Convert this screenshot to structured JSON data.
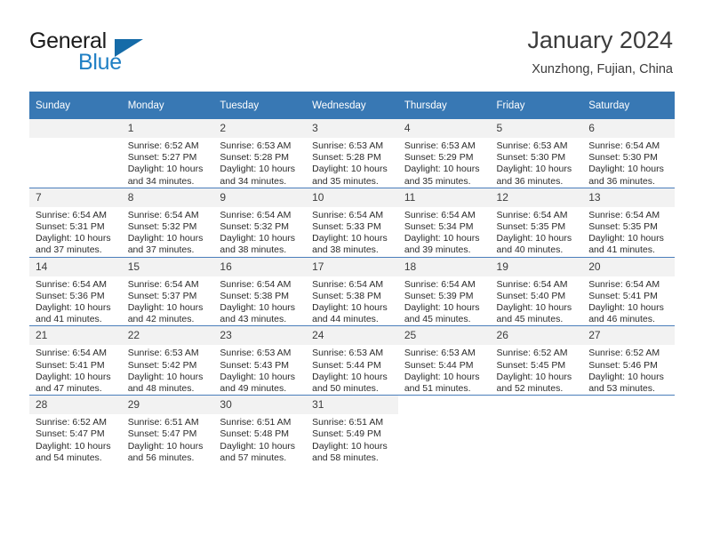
{
  "brand": {
    "name_part1": "General",
    "name_part2": "Blue",
    "triangle_color": "#156ba8",
    "blue_color": "#1f7fc4"
  },
  "header": {
    "title": "January 2024",
    "location": "Xunzhong, Fujian, China"
  },
  "theme": {
    "header_row_bg": "#3878b4",
    "header_row_text": "#ffffff",
    "daynum_bg": "#f2f2f2",
    "row_divider": "#4a7ebb",
    "body_text": "#2b2b2b"
  },
  "weekday_headers": [
    "Sunday",
    "Monday",
    "Tuesday",
    "Wednesday",
    "Thursday",
    "Friday",
    "Saturday"
  ],
  "weeks": [
    [
      {
        "day": "",
        "empty": true,
        "sunrise": "",
        "sunset": "",
        "daylight1": "",
        "daylight2": ""
      },
      {
        "day": "1",
        "sunrise": "Sunrise: 6:52 AM",
        "sunset": "Sunset: 5:27 PM",
        "daylight1": "Daylight: 10 hours",
        "daylight2": "and 34 minutes."
      },
      {
        "day": "2",
        "sunrise": "Sunrise: 6:53 AM",
        "sunset": "Sunset: 5:28 PM",
        "daylight1": "Daylight: 10 hours",
        "daylight2": "and 34 minutes."
      },
      {
        "day": "3",
        "sunrise": "Sunrise: 6:53 AM",
        "sunset": "Sunset: 5:28 PM",
        "daylight1": "Daylight: 10 hours",
        "daylight2": "and 35 minutes."
      },
      {
        "day": "4",
        "sunrise": "Sunrise: 6:53 AM",
        "sunset": "Sunset: 5:29 PM",
        "daylight1": "Daylight: 10 hours",
        "daylight2": "and 35 minutes."
      },
      {
        "day": "5",
        "sunrise": "Sunrise: 6:53 AM",
        "sunset": "Sunset: 5:30 PM",
        "daylight1": "Daylight: 10 hours",
        "daylight2": "and 36 minutes."
      },
      {
        "day": "6",
        "sunrise": "Sunrise: 6:54 AM",
        "sunset": "Sunset: 5:30 PM",
        "daylight1": "Daylight: 10 hours",
        "daylight2": "and 36 minutes."
      }
    ],
    [
      {
        "day": "7",
        "sunrise": "Sunrise: 6:54 AM",
        "sunset": "Sunset: 5:31 PM",
        "daylight1": "Daylight: 10 hours",
        "daylight2": "and 37 minutes."
      },
      {
        "day": "8",
        "sunrise": "Sunrise: 6:54 AM",
        "sunset": "Sunset: 5:32 PM",
        "daylight1": "Daylight: 10 hours",
        "daylight2": "and 37 minutes."
      },
      {
        "day": "9",
        "sunrise": "Sunrise: 6:54 AM",
        "sunset": "Sunset: 5:32 PM",
        "daylight1": "Daylight: 10 hours",
        "daylight2": "and 38 minutes."
      },
      {
        "day": "10",
        "sunrise": "Sunrise: 6:54 AM",
        "sunset": "Sunset: 5:33 PM",
        "daylight1": "Daylight: 10 hours",
        "daylight2": "and 38 minutes."
      },
      {
        "day": "11",
        "sunrise": "Sunrise: 6:54 AM",
        "sunset": "Sunset: 5:34 PM",
        "daylight1": "Daylight: 10 hours",
        "daylight2": "and 39 minutes."
      },
      {
        "day": "12",
        "sunrise": "Sunrise: 6:54 AM",
        "sunset": "Sunset: 5:35 PM",
        "daylight1": "Daylight: 10 hours",
        "daylight2": "and 40 minutes."
      },
      {
        "day": "13",
        "sunrise": "Sunrise: 6:54 AM",
        "sunset": "Sunset: 5:35 PM",
        "daylight1": "Daylight: 10 hours",
        "daylight2": "and 41 minutes."
      }
    ],
    [
      {
        "day": "14",
        "sunrise": "Sunrise: 6:54 AM",
        "sunset": "Sunset: 5:36 PM",
        "daylight1": "Daylight: 10 hours",
        "daylight2": "and 41 minutes."
      },
      {
        "day": "15",
        "sunrise": "Sunrise: 6:54 AM",
        "sunset": "Sunset: 5:37 PM",
        "daylight1": "Daylight: 10 hours",
        "daylight2": "and 42 minutes."
      },
      {
        "day": "16",
        "sunrise": "Sunrise: 6:54 AM",
        "sunset": "Sunset: 5:38 PM",
        "daylight1": "Daylight: 10 hours",
        "daylight2": "and 43 minutes."
      },
      {
        "day": "17",
        "sunrise": "Sunrise: 6:54 AM",
        "sunset": "Sunset: 5:38 PM",
        "daylight1": "Daylight: 10 hours",
        "daylight2": "and 44 minutes."
      },
      {
        "day": "18",
        "sunrise": "Sunrise: 6:54 AM",
        "sunset": "Sunset: 5:39 PM",
        "daylight1": "Daylight: 10 hours",
        "daylight2": "and 45 minutes."
      },
      {
        "day": "19",
        "sunrise": "Sunrise: 6:54 AM",
        "sunset": "Sunset: 5:40 PM",
        "daylight1": "Daylight: 10 hours",
        "daylight2": "and 45 minutes."
      },
      {
        "day": "20",
        "sunrise": "Sunrise: 6:54 AM",
        "sunset": "Sunset: 5:41 PM",
        "daylight1": "Daylight: 10 hours",
        "daylight2": "and 46 minutes."
      }
    ],
    [
      {
        "day": "21",
        "sunrise": "Sunrise: 6:54 AM",
        "sunset": "Sunset: 5:41 PM",
        "daylight1": "Daylight: 10 hours",
        "daylight2": "and 47 minutes."
      },
      {
        "day": "22",
        "sunrise": "Sunrise: 6:53 AM",
        "sunset": "Sunset: 5:42 PM",
        "daylight1": "Daylight: 10 hours",
        "daylight2": "and 48 minutes."
      },
      {
        "day": "23",
        "sunrise": "Sunrise: 6:53 AM",
        "sunset": "Sunset: 5:43 PM",
        "daylight1": "Daylight: 10 hours",
        "daylight2": "and 49 minutes."
      },
      {
        "day": "24",
        "sunrise": "Sunrise: 6:53 AM",
        "sunset": "Sunset: 5:44 PM",
        "daylight1": "Daylight: 10 hours",
        "daylight2": "and 50 minutes."
      },
      {
        "day": "25",
        "sunrise": "Sunrise: 6:53 AM",
        "sunset": "Sunset: 5:44 PM",
        "daylight1": "Daylight: 10 hours",
        "daylight2": "and 51 minutes."
      },
      {
        "day": "26",
        "sunrise": "Sunrise: 6:52 AM",
        "sunset": "Sunset: 5:45 PM",
        "daylight1": "Daylight: 10 hours",
        "daylight2": "and 52 minutes."
      },
      {
        "day": "27",
        "sunrise": "Sunrise: 6:52 AM",
        "sunset": "Sunset: 5:46 PM",
        "daylight1": "Daylight: 10 hours",
        "daylight2": "and 53 minutes."
      }
    ],
    [
      {
        "day": "28",
        "sunrise": "Sunrise: 6:52 AM",
        "sunset": "Sunset: 5:47 PM",
        "daylight1": "Daylight: 10 hours",
        "daylight2": "and 54 minutes."
      },
      {
        "day": "29",
        "sunrise": "Sunrise: 6:51 AM",
        "sunset": "Sunset: 5:47 PM",
        "daylight1": "Daylight: 10 hours",
        "daylight2": "and 56 minutes."
      },
      {
        "day": "30",
        "sunrise": "Sunrise: 6:51 AM",
        "sunset": "Sunset: 5:48 PM",
        "daylight1": "Daylight: 10 hours",
        "daylight2": "and 57 minutes."
      },
      {
        "day": "31",
        "sunrise": "Sunrise: 6:51 AM",
        "sunset": "Sunset: 5:49 PM",
        "daylight1": "Daylight: 10 hours",
        "daylight2": "and 58 minutes."
      },
      {
        "day": "",
        "blank": true,
        "sunrise": "",
        "sunset": "",
        "daylight1": "",
        "daylight2": ""
      },
      {
        "day": "",
        "blank": true,
        "sunrise": "",
        "sunset": "",
        "daylight1": "",
        "daylight2": ""
      },
      {
        "day": "",
        "blank": true,
        "sunrise": "",
        "sunset": "",
        "daylight1": "",
        "daylight2": ""
      }
    ]
  ]
}
